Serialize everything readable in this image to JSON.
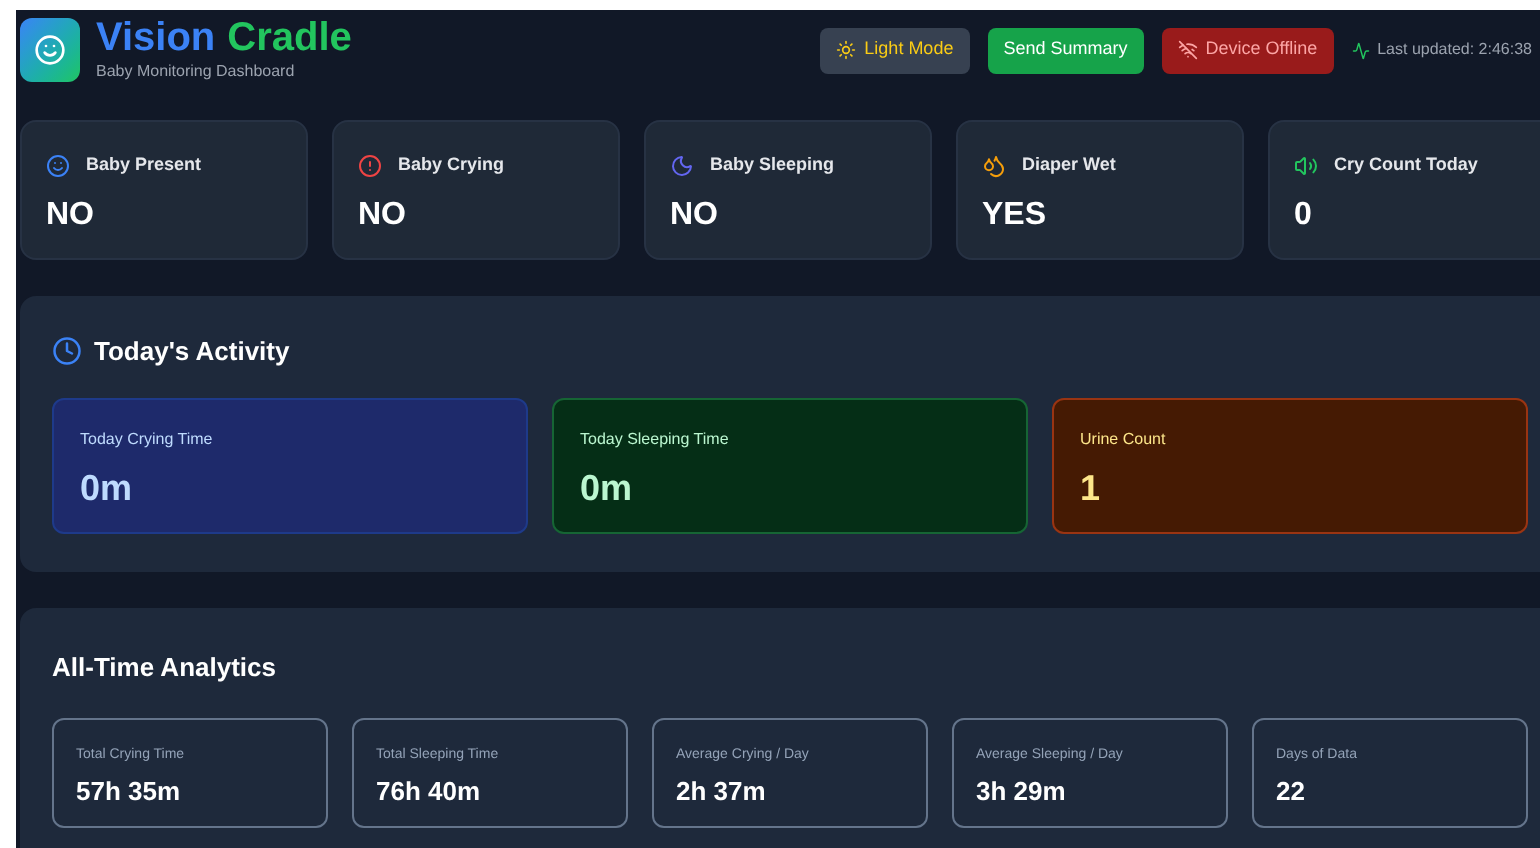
{
  "header": {
    "title_first": "Vision",
    "title_second": "Cradle",
    "subtitle": "Baby Monitoring Dashboard",
    "theme_button": "Light Mode",
    "summary_button": "Send Summary",
    "device_status": {
      "label": "Device Offline",
      "online": false
    },
    "last_updated": "Last updated: 2:46:38"
  },
  "status_cards": [
    {
      "kind": "presence",
      "label": "Baby Present",
      "value": "NO"
    },
    {
      "kind": "crying",
      "label": "Baby Crying",
      "value": "NO"
    },
    {
      "kind": "sleeping",
      "label": "Baby Sleeping",
      "value": "NO"
    },
    {
      "kind": "diaper",
      "label": "Diaper Wet",
      "value": "YES"
    },
    {
      "kind": "count",
      "label": "Cry Count Today",
      "value": "0"
    }
  ],
  "today": {
    "title": "Today's Activity",
    "cards": [
      {
        "label": "Today Crying Time",
        "value": "0m",
        "color": "#1e2a6b"
      },
      {
        "label": "Today Sleeping Time",
        "value": "0m",
        "color": "#052e16"
      },
      {
        "label": "Urine Count",
        "value": "1",
        "color": "#451a03"
      }
    ]
  },
  "analytics": {
    "title": "All-Time Analytics",
    "cards": [
      {
        "label": "Total Crying Time",
        "value": "57h 35m"
      },
      {
        "label": "Total Sleeping Time",
        "value": "76h 40m"
      },
      {
        "label": "Average Crying / Day",
        "value": "2h 37m"
      },
      {
        "label": "Average Sleeping / Day",
        "value": "3h 29m"
      },
      {
        "label": "Days of Data",
        "value": "22"
      }
    ]
  }
}
